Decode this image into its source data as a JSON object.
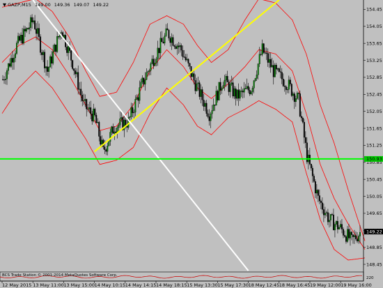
{
  "window": {
    "symbol": "GAZP,M15",
    "ohlc": [
      "149.00",
      "149.36",
      "149.07",
      "149.22"
    ],
    "copyright": "BCS Trade Station © 2001-2014 MetaQuotes Software Corp."
  },
  "colors": {
    "background": "#c0c0c0",
    "candle_up": "#008000",
    "candle_down": "#000000",
    "bollinger_bands": "#ff0000",
    "trendline_up": "#ffff00",
    "trendline_down": "#ffffff",
    "support_line": "#00ff00",
    "current_price_box": "#000000",
    "support_price_box": "#00c800"
  },
  "chart_data": {
    "type": "candlestick",
    "indicators": [
      "Bollinger Bands"
    ],
    "ylim": [
      148.27,
      154.67
    ],
    "y_ticks": [
      "154.45",
      "154.05",
      "153.65",
      "153.25",
      "152.85",
      "152.45",
      "152.05",
      "151.65",
      "151.25",
      "150.85",
      "150.45",
      "150.05",
      "149.65",
      "149.25",
      "148.85",
      "148.45"
    ],
    "x_ticks": [
      "12 May 2015",
      "13 May 11:00",
      "13 May 15:00",
      "14 May 10:15",
      "14 May 14:15",
      "14 May 18:15",
      "15 May 13:30",
      "15 May 17:30",
      "18 May 12:45",
      "18 May 16:45",
      "19 May 12:00",
      "19 May 16:00"
    ],
    "current_price": 149.22,
    "support_level": 150.93,
    "trendlines": [
      {
        "color": "yellow",
        "from": {
          "time": "14 May 10:15",
          "price": 151.1
        },
        "to": {
          "time": "18 May 16:45",
          "price": 154.67
        }
      },
      {
        "color": "white",
        "from": {
          "time": "13 May 11:00",
          "price": 154.67
        },
        "to": {
          "time": "18 May 12:45",
          "price": 148.3
        }
      }
    ],
    "candles_per_tick": 8,
    "close_path": [
      [
        0,
        152.8
      ],
      [
        10,
        153.6
      ],
      [
        22,
        154.2
      ],
      [
        32,
        153.0
      ],
      [
        42,
        154.0
      ],
      [
        50,
        153.2
      ],
      [
        58,
        152.2
      ],
      [
        66,
        151.9
      ],
      [
        72,
        151.1
      ],
      [
        80,
        151.7
      ],
      [
        90,
        151.8
      ],
      [
        100,
        152.7
      ],
      [
        108,
        153.3
      ],
      [
        118,
        153.9
      ],
      [
        128,
        153.5
      ],
      [
        138,
        152.7
      ],
      [
        148,
        152.0
      ],
      [
        158,
        152.8
      ],
      [
        168,
        152.4
      ],
      [
        178,
        152.6
      ],
      [
        186,
        153.5
      ],
      [
        194,
        153.0
      ],
      [
        204,
        152.7
      ],
      [
        212,
        152.3
      ],
      [
        218,
        151.0
      ],
      [
        226,
        150.0
      ],
      [
        234,
        149.5
      ],
      [
        242,
        149.3
      ],
      [
        250,
        149.0
      ],
      [
        256,
        149.2
      ]
    ],
    "bollinger": {
      "upper": [
        [
          0,
          154.5
        ],
        [
          12,
          154.6
        ],
        [
          24,
          154.7
        ],
        [
          36,
          154.4
        ],
        [
          48,
          153.8
        ],
        [
          60,
          153.0
        ],
        [
          70,
          152.4
        ],
        [
          82,
          152.5
        ],
        [
          94,
          153.2
        ],
        [
          106,
          154.1
        ],
        [
          118,
          154.3
        ],
        [
          130,
          154.1
        ],
        [
          140,
          153.6
        ],
        [
          150,
          153.2
        ],
        [
          162,
          153.5
        ],
        [
          174,
          154.2
        ],
        [
          184,
          154.7
        ],
        [
          196,
          154.6
        ],
        [
          208,
          154.2
        ],
        [
          218,
          153.4
        ],
        [
          228,
          152.2
        ],
        [
          238,
          151.3
        ],
        [
          248,
          150.2
        ],
        [
          260,
          149.0
        ]
      ],
      "lower": [
        [
          0,
          152.0
        ],
        [
          12,
          152.6
        ],
        [
          24,
          153.0
        ],
        [
          36,
          152.6
        ],
        [
          48,
          152.0
        ],
        [
          60,
          151.4
        ],
        [
          70,
          150.8
        ],
        [
          82,
          150.9
        ],
        [
          94,
          151.2
        ],
        [
          106,
          152.0
        ],
        [
          118,
          152.6
        ],
        [
          130,
          152.2
        ],
        [
          140,
          151.7
        ],
        [
          150,
          151.5
        ],
        [
          162,
          151.9
        ],
        [
          174,
          152.1
        ],
        [
          184,
          152.3
        ],
        [
          196,
          152.1
        ],
        [
          208,
          151.8
        ],
        [
          218,
          150.6
        ],
        [
          228,
          149.5
        ],
        [
          238,
          148.8
        ],
        [
          248,
          148.55
        ],
        [
          260,
          148.6
        ]
      ],
      "middle": [
        [
          0,
          153.2
        ],
        [
          12,
          153.6
        ],
        [
          24,
          153.8
        ],
        [
          36,
          153.5
        ],
        [
          48,
          152.9
        ],
        [
          60,
          152.2
        ],
        [
          70,
          151.6
        ],
        [
          82,
          151.7
        ],
        [
          94,
          152.2
        ],
        [
          106,
          153.0
        ],
        [
          118,
          153.5
        ],
        [
          130,
          153.1
        ],
        [
          140,
          152.6
        ],
        [
          150,
          152.35
        ],
        [
          162,
          152.7
        ],
        [
          174,
          153.1
        ],
        [
          184,
          153.5
        ],
        [
          196,
          153.4
        ],
        [
          208,
          153.0
        ],
        [
          218,
          152.0
        ],
        [
          228,
          150.8
        ],
        [
          238,
          150.0
        ],
        [
          248,
          149.4
        ],
        [
          260,
          148.8
        ]
      ]
    }
  },
  "price_boxes": {
    "support": "150.93",
    "current": "149.22"
  },
  "footer_right": "220"
}
